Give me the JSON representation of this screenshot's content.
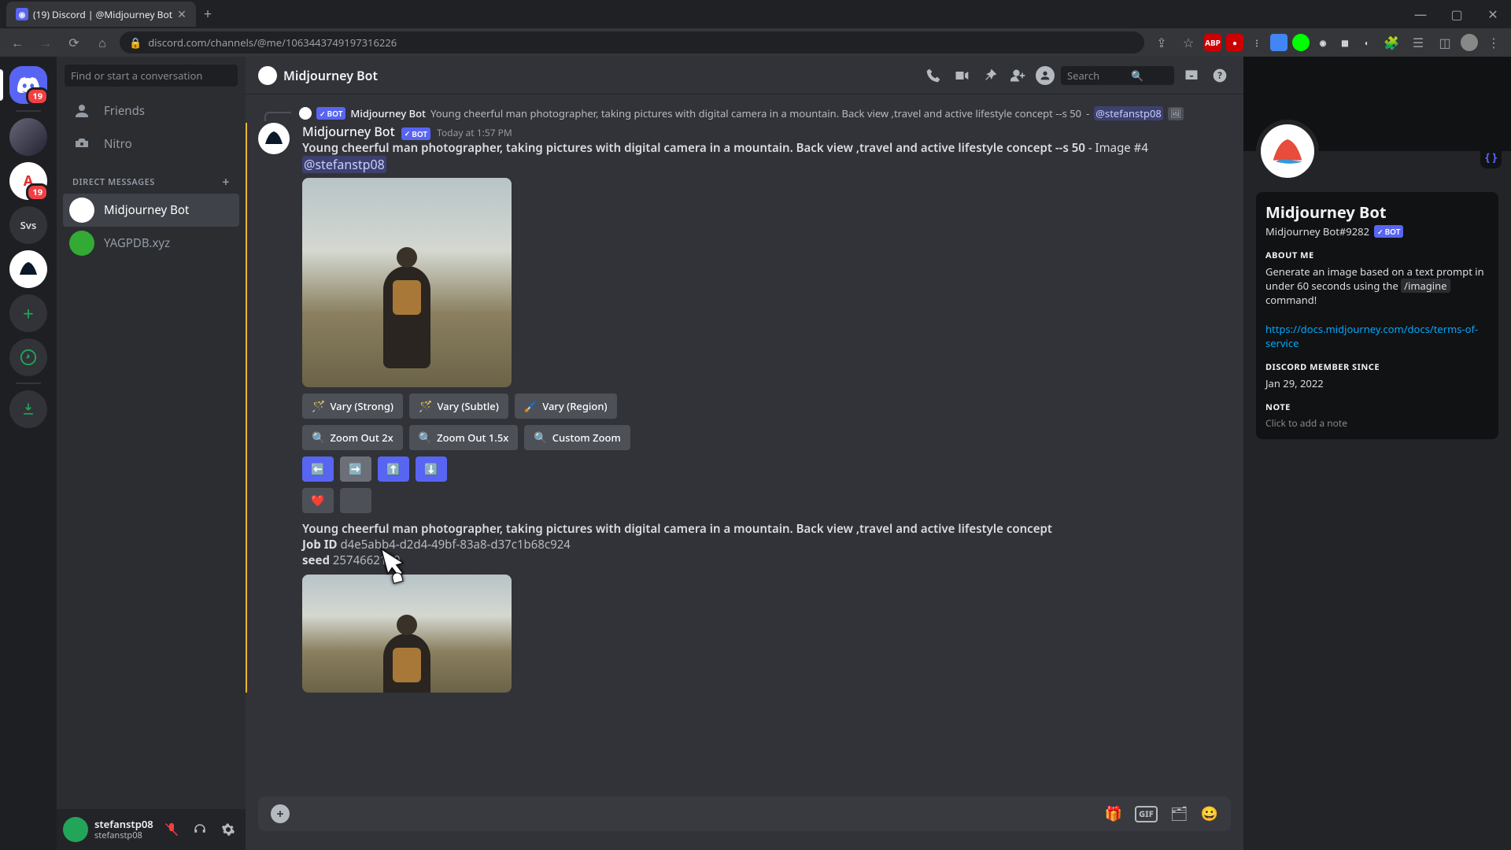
{
  "browser": {
    "tab_title": "(19) Discord | @Midjourney Bot",
    "url": "discord.com/channels/@me/1063443749197316226"
  },
  "rail": {
    "dm_badge": "19",
    "svs_label": "Svs"
  },
  "dm_sidebar": {
    "search_placeholder": "Find or start a conversation",
    "friends_label": "Friends",
    "nitro_label": "Nitro",
    "section_header": "DIRECT MESSAGES",
    "items": [
      {
        "label": "Midjourney Bot"
      },
      {
        "label": "YAGPDB.xyz"
      }
    ]
  },
  "user_panel": {
    "username": "stefanstp08",
    "tag": "stefanstp08"
  },
  "chat_header": {
    "title": "Midjourney Bot",
    "search_placeholder": "Search"
  },
  "reply": {
    "author": "Midjourney Bot",
    "bot_label": "BOT",
    "text": "Young cheerful man photographer, taking pictures with digital camera in a mountain. Back view ,travel and active lifestyle concept --s 50",
    "mention": "@stefanstp08"
  },
  "message": {
    "author": "Midjourney Bot",
    "bot_label": "BOT",
    "timestamp": "Today at 1:57 PM",
    "prompt": "Young cheerful man photographer, taking pictures with digital camera in a mountain. Back view ,travel and active lifestyle concept --s 50",
    "suffix": " - Image #4",
    "mention": "@stefanstp08"
  },
  "buttons": {
    "row1": [
      {
        "emoji": "🪄",
        "label": "Vary (Strong)"
      },
      {
        "emoji": "🪄",
        "label": "Vary (Subtle)"
      },
      {
        "emoji": "🖌️",
        "label": "Vary (Region)"
      }
    ],
    "row2": [
      {
        "emoji": "🔍",
        "label": "Zoom Out 2x"
      },
      {
        "emoji": "🔍",
        "label": "Zoom Out 1.5x"
      },
      {
        "emoji": "🔍",
        "label": "Custom Zoom"
      }
    ],
    "row3": [
      {
        "emoji": "⬅️"
      },
      {
        "emoji": "➡️"
      },
      {
        "emoji": "⬆️"
      },
      {
        "emoji": "⬇️"
      }
    ],
    "row4": [
      {
        "emoji": "❤️"
      },
      {
        "emoji": ""
      }
    ]
  },
  "meta": {
    "desc": "Young cheerful man photographer, taking pictures with digital camera in a mountain. Back view ,travel and active lifestyle concept",
    "job_id_label": "Job ID",
    "job_id": "d4e5abb4-d2d4-49bf-83a8-d37c1b68c924",
    "seed_label": "seed",
    "seed": "2574662170"
  },
  "composer": {
    "gif_label": "GIF"
  },
  "profile": {
    "name": "Midjourney Bot",
    "tag": "Midjourney Bot#9282",
    "bot_label": "BOT",
    "about_label": "ABOUT ME",
    "about_text_1": "Generate an image based on a text prompt in under 60 seconds using the ",
    "about_cmd": "/imagine",
    "about_text_2": " command!",
    "link": "https://docs.midjourney.com/docs/terms-of-service",
    "member_since_label": "DISCORD MEMBER SINCE",
    "member_since": "Jan 29, 2022",
    "note_label": "NOTE",
    "note_placeholder": "Click to add a note"
  }
}
